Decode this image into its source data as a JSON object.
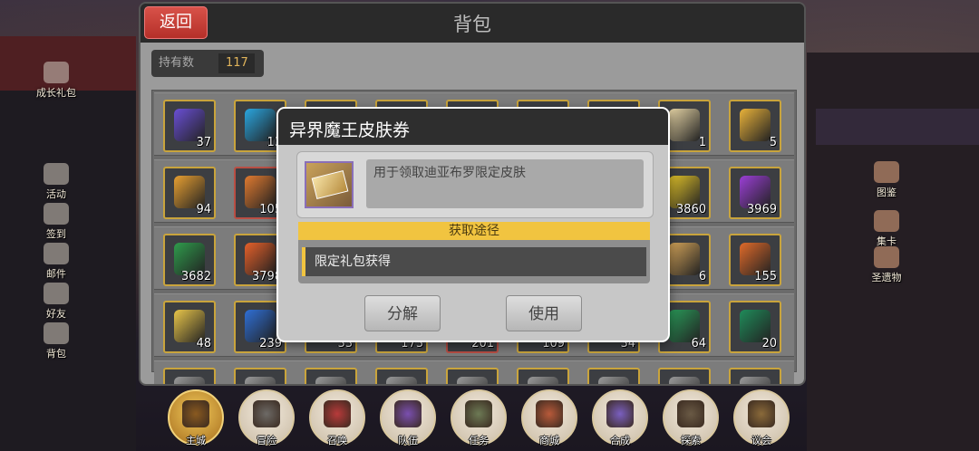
{
  "bag": {
    "back_label": "返回",
    "title": "背包",
    "count_label": "持有数",
    "count_value": "117"
  },
  "grid_quantities": [
    [
      "37",
      "13",
      "",
      "",
      "",
      "",
      "",
      "1",
      "5"
    ],
    [
      "94",
      "105",
      "",
      "",
      "",
      "",
      "",
      "3860",
      "3969"
    ],
    [
      "3682",
      "3798",
      "",
      "",
      "",
      "",
      "",
      "6",
      "155"
    ],
    [
      "48",
      "239",
      "33",
      "173",
      "201",
      "109",
      "34",
      "64",
      "20"
    ]
  ],
  "popup": {
    "title": "异界魔王皮肤券",
    "description": "用于领取迪亚布罗限定皮肤",
    "source_header": "获取途径",
    "source_item": "限定礼包获得",
    "decompose_label": "分解",
    "use_label": "使用"
  },
  "left_sidebar": [
    {
      "label": "成长礼包"
    },
    {
      "label": "活动"
    },
    {
      "label": "签到"
    },
    {
      "label": "邮件"
    },
    {
      "label": "好友"
    },
    {
      "label": "背包"
    }
  ],
  "right_sidebar": [
    {
      "label": "图鉴"
    },
    {
      "label": "集卡"
    },
    {
      "label": "圣遗物"
    }
  ],
  "bottom_nav": [
    {
      "label": "主城",
      "icon": "castle-icon",
      "active": true
    },
    {
      "label": "冒险",
      "icon": "swords-icon"
    },
    {
      "label": "召唤",
      "icon": "summon-card-icon"
    },
    {
      "label": "队伍",
      "icon": "team-shield-icon"
    },
    {
      "label": "任务",
      "icon": "scroll-icon"
    },
    {
      "label": "商城",
      "icon": "shop-tree-icon"
    },
    {
      "label": "合成",
      "icon": "crystal-icon"
    },
    {
      "label": "探索",
      "icon": "compass-tools-icon"
    },
    {
      "label": "议会",
      "icon": "council-icon"
    }
  ],
  "colors": {
    "back_button": "#c8423a",
    "accent_gold": "#f1c440",
    "panel_dark": "#2e2e2e"
  }
}
